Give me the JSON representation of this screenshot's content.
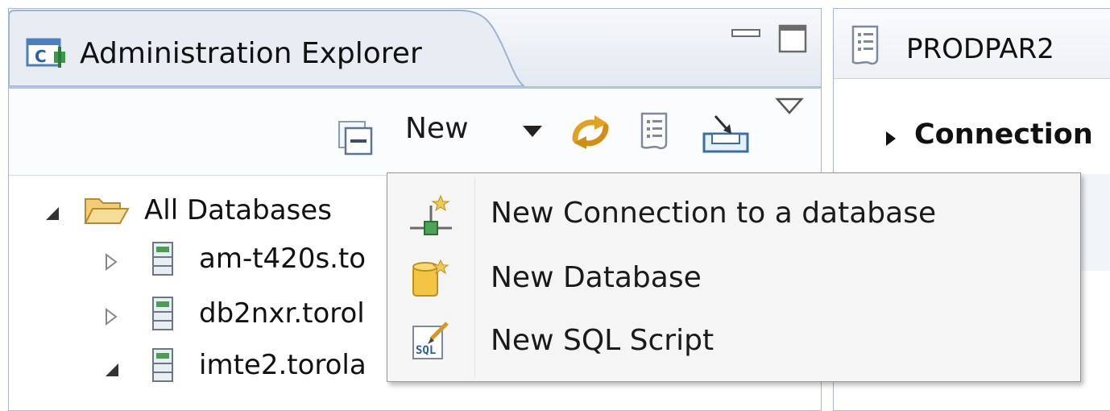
{
  "left_view": {
    "title": "Administration Explorer",
    "icon": "administration-explorer-icon"
  },
  "toolbar": {
    "new_label": "New",
    "icons": [
      "collapse-all-icon",
      "dropdown-arrow-icon",
      "refresh-sync-icon",
      "properties-icon",
      "import-icon",
      "view-menu-icon"
    ]
  },
  "tree": {
    "root": "All Databases",
    "items": [
      {
        "label": "am-t420s.to",
        "state": "collapsed"
      },
      {
        "label": "db2nxr.torol",
        "state": "collapsed"
      },
      {
        "label": "imte2.torola",
        "state": "expanded"
      }
    ]
  },
  "right_view": {
    "title": "PRODPAR2",
    "section": "Connection"
  },
  "new_menu": {
    "items": [
      {
        "label": "New Connection to a database",
        "icon": "new-connection-icon"
      },
      {
        "label": "New Database",
        "icon": "new-database-icon"
      },
      {
        "label": "New SQL Script",
        "icon": "sql-script-icon"
      }
    ]
  },
  "colors": {
    "tab_border": "#9fb3cf",
    "selected_tab": "#e9eef5",
    "menu_bg": "#f5f5f5",
    "folder": "#e8b84a",
    "accent_blue": "#4a7fc1"
  }
}
